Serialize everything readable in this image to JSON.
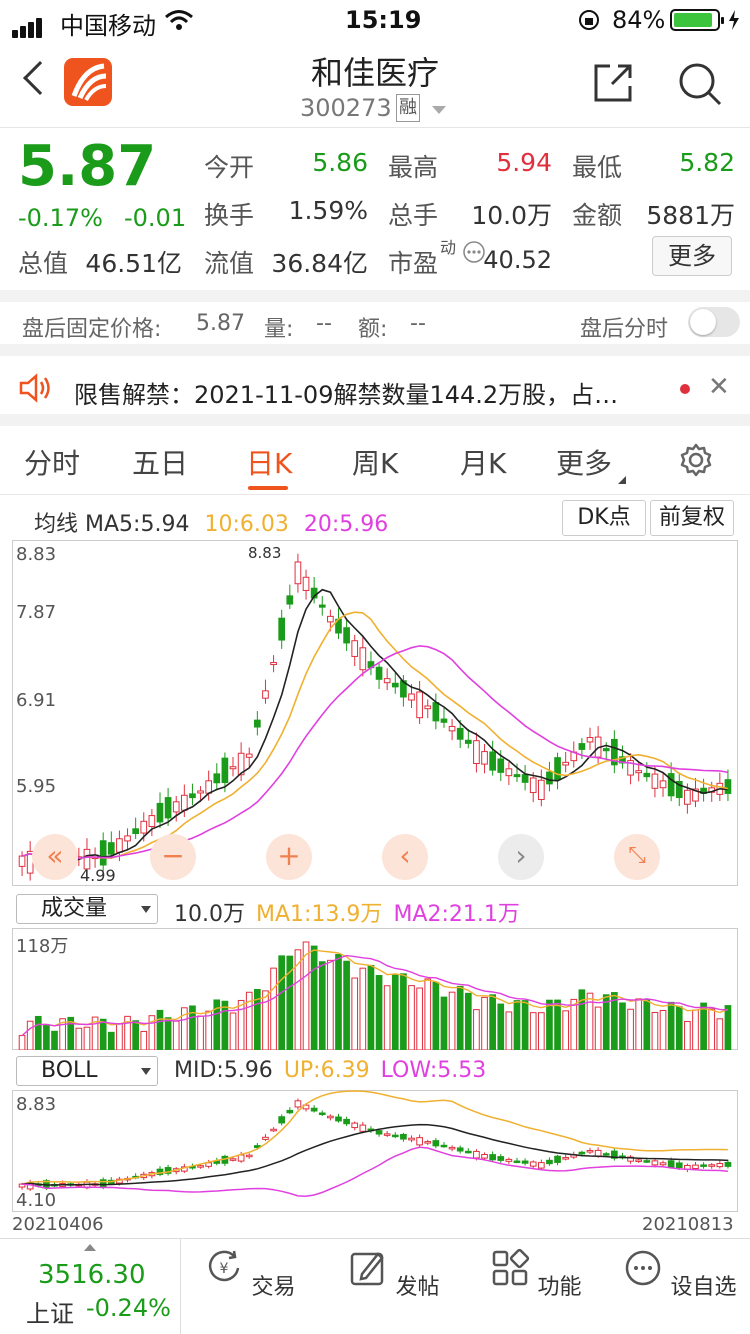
{
  "status_bar": {
    "carrier": "中国移动",
    "time": "15:19",
    "battery": "84%"
  },
  "header": {
    "title": "和佳医疗",
    "code": "300273",
    "margin_tag": "融"
  },
  "quote": {
    "price": "5.87",
    "change_pct": "-0.17%",
    "change": "-0.01",
    "open_label": "今开",
    "open": "5.86",
    "high_label": "最高",
    "high": "5.94",
    "low_label": "最低",
    "low": "5.82",
    "turnover_label": "换手",
    "turnover": "1.59%",
    "volume_label": "总手",
    "volume": "10.0万",
    "amount_label": "金额",
    "amount": "5881万",
    "mktcap_label": "总值",
    "mktcap": "46.51亿",
    "float_label": "流值",
    "float": "36.84亿",
    "pe_label": "市盈",
    "pe_sup": "动",
    "pe": "40.52",
    "more": "更多"
  },
  "after_hours": {
    "label": "盘后固定价格:",
    "price": "5.87",
    "vol_label": "量:",
    "vol": "--",
    "amt_label": "额:",
    "amt": "--",
    "toggle_label": "盘后分时"
  },
  "notice": {
    "text": "限售解禁：2021-11-09解禁数量144.2万股，占…"
  },
  "tabs": [
    "分时",
    "五日",
    "日K",
    "周K",
    "月K",
    "更多"
  ],
  "chart": {
    "ma_label": "均线",
    "ma5": "MA5:5.94",
    "ma10": "10:6.03",
    "ma20": "20:5.96",
    "dk_button": "DK点",
    "adjust_button": "前复权",
    "price_ticks": [
      "8.83",
      "7.87",
      "6.91",
      "5.95",
      "4.99"
    ],
    "high_marker": "8.83",
    "low_marker": "4.99",
    "volume_select": "成交量",
    "volume_value": "10.0万",
    "vol_ma1": "MA1:13.9万",
    "vol_ma2": "MA2:21.1万",
    "vol_tick": "118万",
    "boll_select": "BOLL",
    "boll_mid": "MID:5.96",
    "boll_up": "UP:6.39",
    "boll_low": "LOW:5.53",
    "boll_top_tick": "8.83",
    "boll_bottom_tick": "4.10",
    "date_start": "20210406",
    "date_end": "20210813",
    "colors": {
      "up": "#e0303e",
      "down": "#1a9b1a",
      "ma5": "#222222",
      "ma10": "#f0b030",
      "ma20": "#e040e0"
    }
  },
  "bottom_bar": {
    "index_value": "3516.30",
    "index_name": "上证",
    "index_change": "-0.24%",
    "items": [
      "交易",
      "发帖",
      "功能",
      "设自选"
    ]
  }
}
